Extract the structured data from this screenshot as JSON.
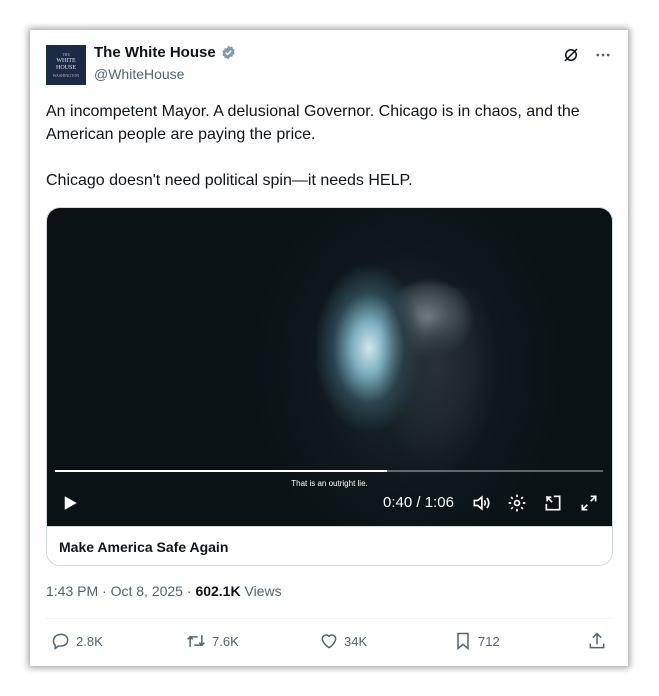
{
  "account": {
    "avatar_text": [
      "THE",
      "WHITE",
      "HOUSE",
      "WASHINGTON"
    ],
    "name": "The White House",
    "handle": "@WhiteHouse",
    "verified_color": "#829aab"
  },
  "post": {
    "paragraph1": "An incompetent Mayor. A delusional Governor. Chicago is in chaos, and the American people are paying the price.",
    "paragraph2": "Chicago doesn't need political spin—it needs HELP."
  },
  "video": {
    "caption": "That is an outright lie.",
    "current_time": "0:40",
    "separator": "/",
    "duration": "1:06",
    "progress_fraction": 0.606,
    "title": "Make America Safe Again"
  },
  "meta": {
    "time": "1:43 PM",
    "dot1": "·",
    "date": "Oct 8, 2025",
    "dot2": "·",
    "views_count": "602.1K",
    "views_label": "Views"
  },
  "actions": {
    "replies": "2.8K",
    "reposts": "7.6K",
    "likes": "34K",
    "bookmarks": "712"
  },
  "colors": {
    "text": "#0f1419",
    "secondary": "#536471",
    "border": "#cfd9de"
  }
}
